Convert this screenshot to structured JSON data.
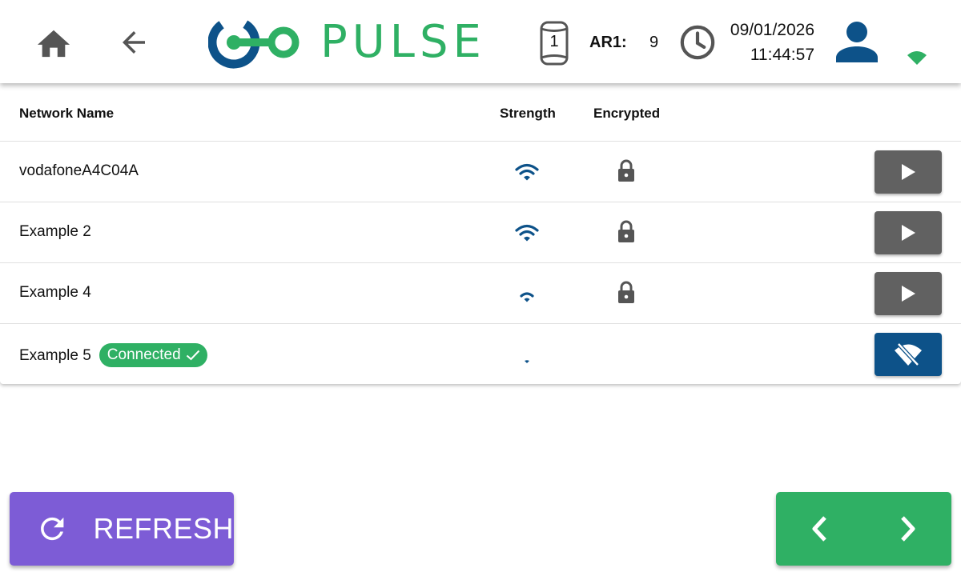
{
  "colors": {
    "brand_green": "#2fb064",
    "brand_blue": "#0d5289",
    "refresh_purple": "#7d5cd6",
    "action_gray": "#616161",
    "icon_gray": "#555555"
  },
  "header": {
    "home_icon": "home-icon",
    "back_icon": "arrow-left-icon",
    "logo_text": "PULSE",
    "bottle_count": "1",
    "ar_label": "AR1:",
    "ar_value": "9",
    "date": "09/01/2026",
    "time": "11:44:57",
    "user_icon": "user-icon",
    "wifi_status_icon": "wifi-icon"
  },
  "table": {
    "columns": [
      "Network Name",
      "Strength",
      "Encrypted"
    ],
    "rows": [
      {
        "name": "vodafoneA4C04A",
        "strength_bars": 3,
        "encrypted": true,
        "action": "connect"
      },
      {
        "name": "Example 2",
        "strength_bars": 3,
        "encrypted": true,
        "action": "connect"
      },
      {
        "name": "Example 4",
        "strength_bars": 2,
        "encrypted": true,
        "action": "connect"
      },
      {
        "name": "Example 5",
        "badge": "Connected",
        "strength_bars": 1,
        "encrypted": false,
        "action": "disconnect"
      }
    ]
  },
  "footer": {
    "refresh_label": "REFRESH",
    "prev_icon": "chevron-left-icon",
    "next_icon": "chevron-right-icon"
  }
}
